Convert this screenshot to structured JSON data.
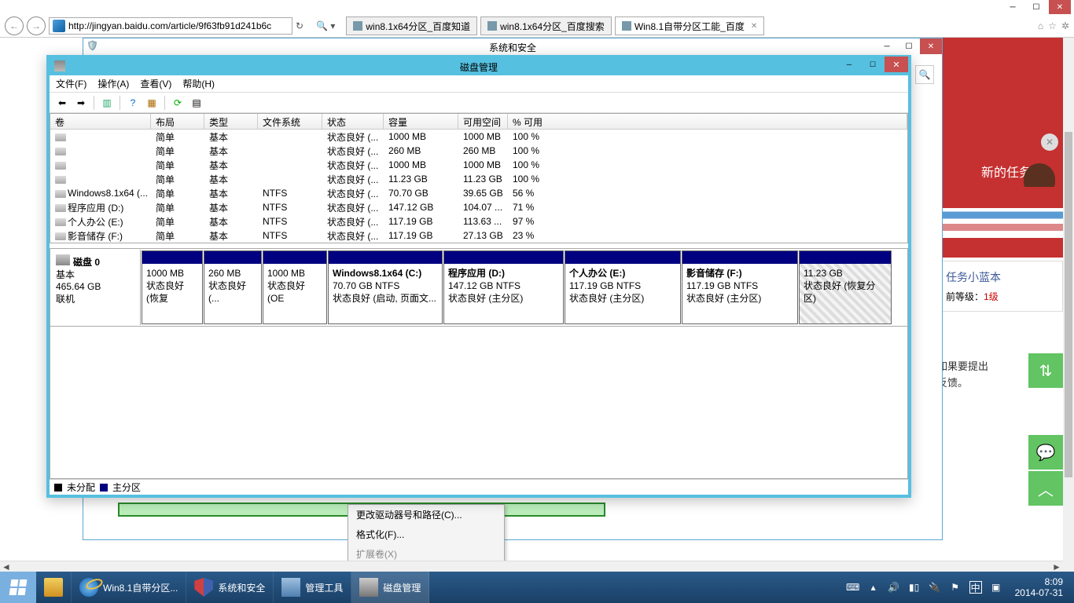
{
  "browser": {
    "url": "http://jingyan.baidu.com/article/9f63fb91d241b6c",
    "tabs": [
      {
        "label": "win8.1x64分区_百度知道"
      },
      {
        "label": "win8.1x64分区_百度搜索"
      },
      {
        "label": "Win8.1自带分区工能_百度",
        "active": true
      }
    ],
    "top_icons": {
      "home": "⌂",
      "star": "☆",
      "gear": "✲"
    }
  },
  "secondary_window": {
    "title": "系统和安全"
  },
  "sidebar": {
    "banner_text": "新的任务哦！",
    "task_title": "任务小蓝本",
    "level_label": "前等级：",
    "level_value": "1级",
    "feedback": "如果要提出\n反馈。"
  },
  "context_menu": {
    "items": [
      {
        "label": "更改驱动器号和路径(C)..."
      },
      {
        "label": "格式化(F)..."
      },
      {
        "label": "扩展卷(X)",
        "disabled": true
      }
    ]
  },
  "dm": {
    "title": "磁盘管理",
    "menu": {
      "file": "文件(F)",
      "action": "操作(A)",
      "view": "查看(V)",
      "help": "帮助(H)"
    },
    "columns": {
      "vol": "卷",
      "layout": "布局",
      "type": "类型",
      "fs": "文件系统",
      "status": "状态",
      "capacity": "容量",
      "free": "可用空间",
      "pct": "% 可用"
    },
    "volumes": [
      {
        "name": "",
        "layout": "简单",
        "type": "基本",
        "fs": "",
        "status": "状态良好 (...",
        "cap": "1000 MB",
        "free": "1000 MB",
        "pct": "100 %"
      },
      {
        "name": "",
        "layout": "简单",
        "type": "基本",
        "fs": "",
        "status": "状态良好 (...",
        "cap": "260 MB",
        "free": "260 MB",
        "pct": "100 %"
      },
      {
        "name": "",
        "layout": "简单",
        "type": "基本",
        "fs": "",
        "status": "状态良好 (...",
        "cap": "1000 MB",
        "free": "1000 MB",
        "pct": "100 %"
      },
      {
        "name": "",
        "layout": "简单",
        "type": "基本",
        "fs": "",
        "status": "状态良好 (...",
        "cap": "11.23 GB",
        "free": "11.23 GB",
        "pct": "100 %"
      },
      {
        "name": "Windows8.1x64 (...",
        "layout": "简单",
        "type": "基本",
        "fs": "NTFS",
        "status": "状态良好 (...",
        "cap": "70.70 GB",
        "free": "39.65 GB",
        "pct": "56 %"
      },
      {
        "name": "程序应用 (D:)",
        "layout": "简单",
        "type": "基本",
        "fs": "NTFS",
        "status": "状态良好 (...",
        "cap": "147.12 GB",
        "free": "104.07 ...",
        "pct": "71 %"
      },
      {
        "name": "个人办公 (E:)",
        "layout": "简单",
        "type": "基本",
        "fs": "NTFS",
        "status": "状态良好 (...",
        "cap": "117.19 GB",
        "free": "113.63 ...",
        "pct": "97 %"
      },
      {
        "name": "影音储存 (F:)",
        "layout": "简单",
        "type": "基本",
        "fs": "NTFS",
        "status": "状态良好 (...",
        "cap": "117.19 GB",
        "free": "27.13 GB",
        "pct": "23 %"
      }
    ],
    "disk": {
      "label": "磁盘 0",
      "type": "基本",
      "size": "465.64 GB",
      "status": "联机"
    },
    "partitions": [
      {
        "title": "",
        "line2": "1000 MB",
        "line3": "状态良好 (恢复",
        "w": 78
      },
      {
        "title": "",
        "line2": "260 MB",
        "line3": "状态良好 (...",
        "w": 74
      },
      {
        "title": "",
        "line2": "1000 MB",
        "line3": "状态良好 (OE",
        "w": 82
      },
      {
        "title": "Windows8.1x64  (C:)",
        "line2": "70.70 GB NTFS",
        "line3": "状态良好 (启动, 页面文...",
        "w": 146
      },
      {
        "title": "程序应用  (D:)",
        "line2": "147.12 GB NTFS",
        "line3": "状态良好 (主分区)",
        "w": 153
      },
      {
        "title": "个人办公  (E:)",
        "line2": "117.19 GB NTFS",
        "line3": "状态良好 (主分区)",
        "w": 148
      },
      {
        "title": "影音储存  (F:)",
        "line2": "117.19 GB NTFS",
        "line3": "状态良好 (主分区)",
        "w": 148
      },
      {
        "title": "",
        "line2": "11.23 GB",
        "line3": "状态良好 (恢复分区)",
        "w": 118,
        "hatched": true
      }
    ],
    "legend": {
      "unalloc": "未分配",
      "primary": "主分区"
    }
  },
  "taskbar": {
    "items": [
      {
        "label": "Win8.1自带分区...",
        "icon": "ie"
      },
      {
        "label": "系统和安全",
        "icon": "shield"
      },
      {
        "label": "管理工具",
        "icon": "tools"
      },
      {
        "label": "磁盘管理",
        "icon": "disk",
        "active": true
      }
    ],
    "clock": {
      "time": "8:09",
      "date": "2014-07-31"
    },
    "ime": "中"
  }
}
